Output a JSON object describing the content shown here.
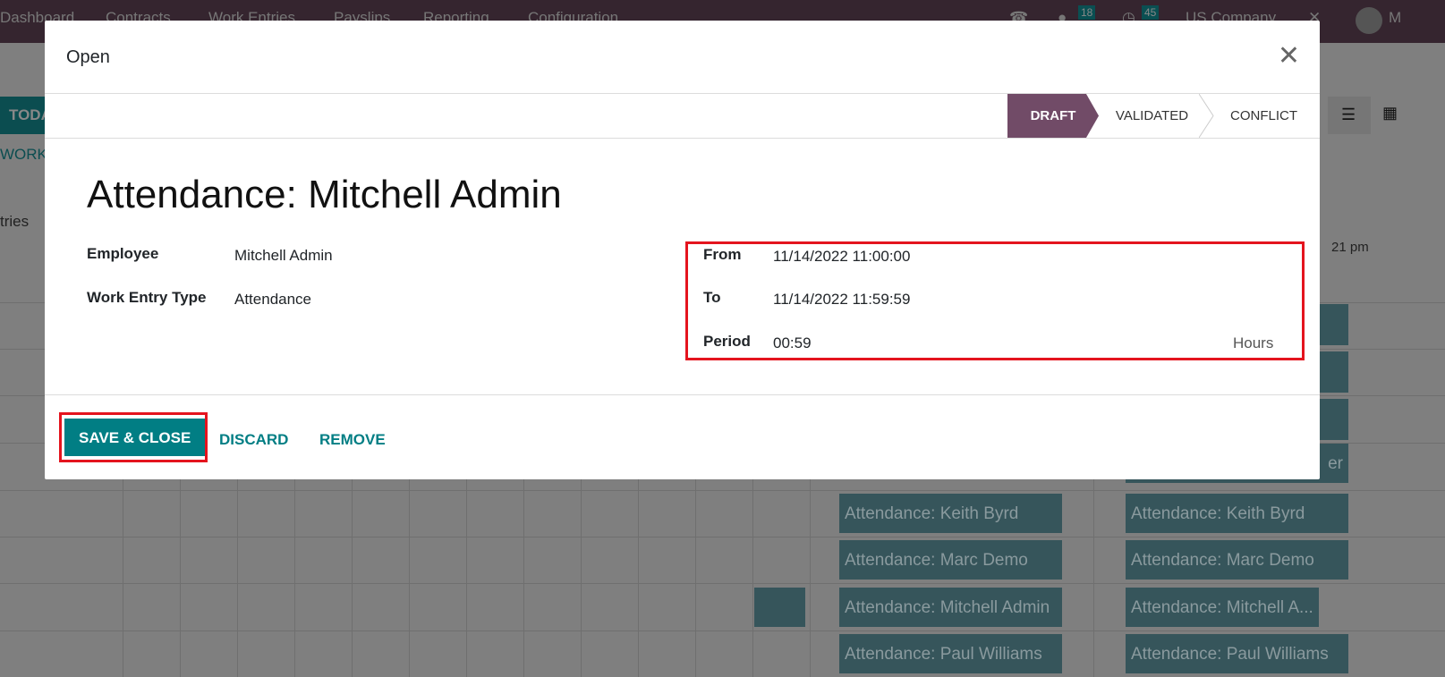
{
  "navbar": {
    "menu": [
      "Dashboard",
      "Contracts",
      "Work Entries",
      "Payslips",
      "Reporting",
      "Configuration"
    ],
    "messages_count": "18",
    "activities_count": "45",
    "company": "US Company",
    "user_initial": "M"
  },
  "background": {
    "today_label": "TODA",
    "work_label": "WORK E",
    "entries_label": "tries",
    "time_label": "21 pm",
    "pills": [
      "Attendance: Keith Byrd",
      "Attendance: Keith Byrd",
      "Attendance: Marc Demo",
      "Attendance: Marc Demo",
      "Attendance: Mitchell Admin",
      "Attendance: Mitchell A...",
      "Attendance: Paul Williams",
      "Attendance: Paul Williams",
      "er"
    ]
  },
  "modal": {
    "title": "Open",
    "stages": [
      "DRAFT",
      "VALIDATED",
      "CONFLICT"
    ],
    "active_stage": "DRAFT",
    "heading": "Attendance: Mitchell Admin",
    "fields": {
      "employee_label": "Employee",
      "employee": "Mitchell Admin",
      "type_label": "Work Entry Type",
      "type": "Attendance",
      "from_label": "From",
      "from": "11/14/2022 11:00:00",
      "to_label": "To",
      "to": "11/14/2022 11:59:59",
      "period_label": "Period",
      "period": "00:59",
      "period_unit": "Hours"
    },
    "buttons": {
      "save": "SAVE & CLOSE",
      "discard": "DISCARD",
      "remove": "REMOVE"
    }
  },
  "colors": {
    "brand": "#714b67",
    "accent": "#017e84",
    "highlight": "#e4141e"
  }
}
